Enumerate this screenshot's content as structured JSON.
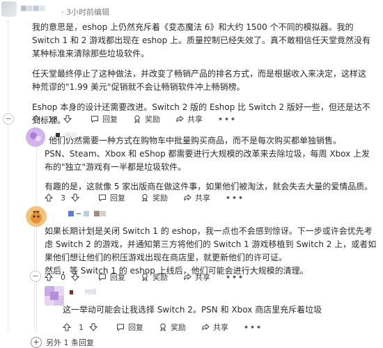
{
  "comment1": {
    "meta": "· 3小时前编辑",
    "paragraphs": [
      "我的意思是，eshop 上仍然充斥着《变态魔法 6》和大约 1500 个不同的模拟器。我的 Switch 1 和 2 游戏都出现在 eshop 上。质量控制已经失效了。真不敢相信任天堂竟然没有某种标准来清除那些垃圾软件。",
      "任天堂最终停止了这种做法，并改变了畅销产品的排名方式，而是根据收入来决定，这样这种荒谬的\"1.99 美元\"促销就不会让畅销软件冲上畅销榜。",
      "Eshop 本身的设计还需要改进。Switch 2 版的 Eshop 比 Switch 2 版好一些，但还是达不到标准。",
      "哦，他们仍然需要一种方式在购物车中批量购买商品，而不是每次购买都单独销售。"
    ],
    "votes": "18",
    "reply": "回复",
    "award": "奖励",
    "share": "共享",
    "more": "•••"
  },
  "comment2": {
    "paragraphs": [
      "PSN、Steam、Xbox 和 eShop 都需要进行大规模的改革来去除垃圾，每周 Xbox 上发布的\"独立\"游戏有一半都是垃圾软件。",
      "有趣的是，这就像 5 家出版商在做这件事，如果他们被淘汰，就会失去大量的爱情品质。"
    ],
    "votes": "3",
    "reply": "回复",
    "award": "奖励",
    "share": "共享",
    "more": "•••"
  },
  "comment3": {
    "paragraphs": [
      "如果长期计划是关闭 Switch 1 的 eshop，我一点也不会感到惊讶。下一步或许会优先考虑 Switch 2 的游戏，并通知第三方将他们的 Switch 1 游戏移植到 Switch 2 上，或者如果他们想让他们的积压游戏出现在商店里，就更新他们的许可证。",
      "然后，等 Switch 1 的 eshop 上线后，他们可能会进行大规模的清理。"
    ],
    "votes": "0",
    "reply": "回复",
    "award": "奖励",
    "share": "共享",
    "more": "•••"
  },
  "comment4": {
    "username_suffix": "吋间",
    "paragraphs": [
      "这一举动可能会让我选择 Switch 2。PSN 和 Xbox 商店里充斥着垃圾"
    ],
    "votes": "1",
    "reply": "回复",
    "award": "奖励",
    "share": "共享",
    "more": "•••"
  },
  "footer": {
    "more_replies": "另外 1 条回复"
  }
}
